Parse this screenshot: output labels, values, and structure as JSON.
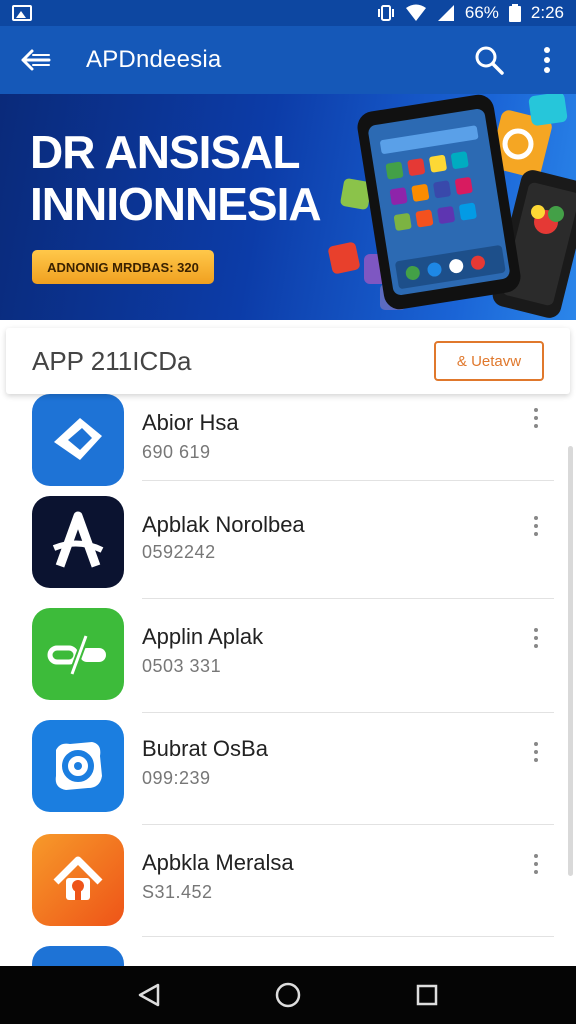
{
  "status_bar": {
    "battery": "66%",
    "time": "2:26"
  },
  "app_bar": {
    "title": "APDndeesia"
  },
  "banner": {
    "title_line1": "DR ANSISAL",
    "title_line2": "INNIONNESIA",
    "badge": "ADNONIG MRDBAS: 320"
  },
  "section": {
    "title": "APP 211ICDa",
    "action_label": "& Uetavw"
  },
  "apps": [
    {
      "name": "Abior Hsa",
      "meta": "690 619",
      "icon": "blue-chevron-icon",
      "color": "#1e73d6"
    },
    {
      "name": "Apblak Norolbea",
      "meta": "0592242",
      "icon": "letter-a-icon",
      "color": "#0b1330"
    },
    {
      "name": "Applin Aplak",
      "meta": "0503 331",
      "icon": "green-link-icon",
      "color": "#3dbb3a"
    },
    {
      "name": "Bubrat OsBa",
      "meta": "099:239",
      "icon": "blue-at-icon",
      "color": "#1b7ee0"
    },
    {
      "name": "Apbkla Meralsa",
      "meta": "S31.452",
      "icon": "orange-home-icon",
      "color": "#f26a1c"
    }
  ]
}
